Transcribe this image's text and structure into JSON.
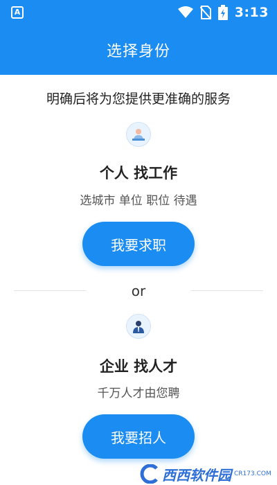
{
  "status_bar": {
    "app_icon_letter": "A",
    "time": "3:13"
  },
  "header": {
    "title": "选择身份"
  },
  "intro": "明确后将为您提供更准确的服务",
  "job_seeker": {
    "title": "个人 找工作",
    "subtitle": "选城市 单位 职位 待遇",
    "button_label": "我要求职"
  },
  "divider_text": "or",
  "employer": {
    "title": "企业 找人才",
    "subtitle": "千万人才由您聘",
    "button_label": "我要招人"
  },
  "watermark": {
    "brand": "西西软件园",
    "site": "CR173.COM"
  },
  "colors": {
    "primary": "#1a8cf2",
    "text": "#222222",
    "subtext": "#555555"
  }
}
